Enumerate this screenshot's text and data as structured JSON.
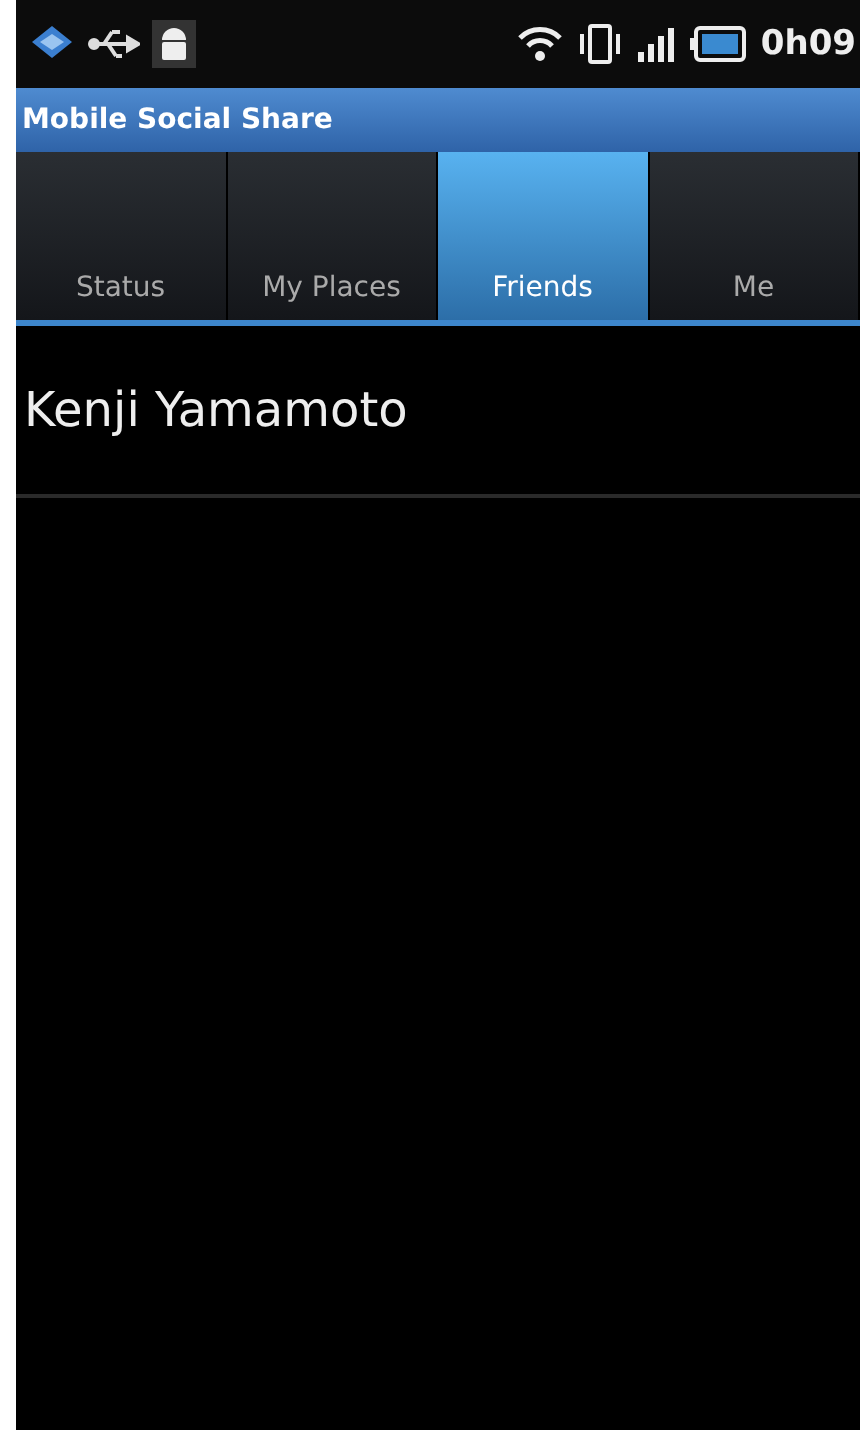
{
  "status_bar": {
    "time": "0h09"
  },
  "title_bar": {
    "title": "Mobile Social Share"
  },
  "tabs": [
    {
      "label": "Status",
      "selected": false
    },
    {
      "label": "My Places",
      "selected": false
    },
    {
      "label": "Friends",
      "selected": true
    },
    {
      "label": "Me",
      "selected": false
    }
  ],
  "friends": [
    {
      "name": "Kenji Yamamoto"
    }
  ]
}
